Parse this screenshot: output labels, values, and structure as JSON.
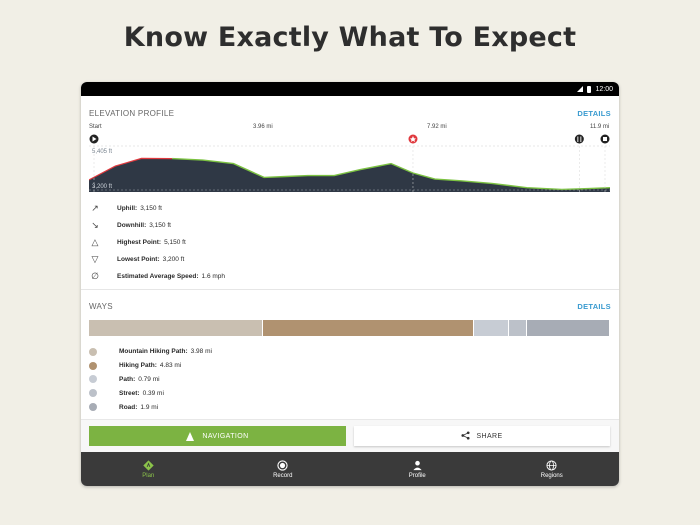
{
  "headline": "Know Exactly What To Expect",
  "status_bar": {
    "time": "12:00"
  },
  "elevation": {
    "title": "ELEVATION PROFILE",
    "details": "DETAILS",
    "ticks": [
      "Start",
      "3.96 mi",
      "7.92 mi",
      "11.9 mi"
    ],
    "y_labels": [
      "5,405 ft",
      "3,200 ft"
    ],
    "stats": [
      {
        "icon": "uphill-icon",
        "glyph": "↗",
        "label": "Uphill:",
        "value": "3,150 ft"
      },
      {
        "icon": "downhill-icon",
        "glyph": "↘",
        "label": "Downhill:",
        "value": "3,150 ft"
      },
      {
        "icon": "highest-point-icon",
        "glyph": "△",
        "label": "Highest Point:",
        "value": "5,150 ft"
      },
      {
        "icon": "lowest-point-icon",
        "glyph": "▽",
        "label": "Lowest Point:",
        "value": "3,200 ft"
      },
      {
        "icon": "average-speed-icon",
        "glyph": "∅",
        "label": "Estimated Average Speed:",
        "value": "1.6 mph"
      }
    ]
  },
  "ways": {
    "title": "WAYS",
    "details": "DETAILS",
    "segments": [
      {
        "name": "Mountain Hiking Path",
        "color": "#c9bfb1",
        "share": 0.334
      },
      {
        "name": "Hiking Path",
        "color": "#b09270",
        "share": 0.405
      },
      {
        "name": "Path",
        "color": "#c7ccd4",
        "share": 0.068
      },
      {
        "name": "Street",
        "color": "#bcc1c9",
        "share": 0.034
      },
      {
        "name": "Road",
        "color": "#a7acb5",
        "share": 0.159
      }
    ],
    "legend": [
      {
        "label": "Mountain Hiking Path:",
        "value": "3.98 mi",
        "color": "#c9bfb1"
      },
      {
        "label": "Hiking Path:",
        "value": "4.83 mi",
        "color": "#b09270"
      },
      {
        "label": "Path:",
        "value": "0.79 mi",
        "color": "#c7ccd4"
      },
      {
        "label": "Street:",
        "value": "0.39 mi",
        "color": "#bcc1c9"
      },
      {
        "label": "Road:",
        "value": "1.9 mi",
        "color": "#a7acb5"
      }
    ]
  },
  "actions": {
    "navigation": "NAVIGATION",
    "share": "SHARE"
  },
  "nav": [
    {
      "label": "Plan",
      "icon": "plan-icon",
      "active": true
    },
    {
      "label": "Record",
      "icon": "record-icon",
      "active": false
    },
    {
      "label": "Profile",
      "icon": "profile-icon",
      "active": false
    },
    {
      "label": "Regions",
      "icon": "regions-icon",
      "active": false
    }
  ],
  "chart_data": {
    "type": "area",
    "x_unit": "mi",
    "y_unit": "ft",
    "x": [
      0,
      0.6,
      1.2,
      1.9,
      2.6,
      3.3,
      4.0,
      4.5,
      5.0,
      5.6,
      6.2,
      6.9,
      7.4,
      7.9,
      8.5,
      9.2,
      10.0,
      10.8,
      11.4,
      11.9
    ],
    "y": [
      3900,
      4700,
      5150,
      5140,
      5050,
      4850,
      4050,
      4100,
      4150,
      4150,
      4500,
      4850,
      4300,
      3950,
      3850,
      3700,
      3450,
      3350,
      3400,
      3450
    ],
    "ylim": [
      3200,
      5405
    ],
    "xlim": [
      0,
      11.9
    ],
    "waypoints": [
      {
        "icon": "start-flag-icon",
        "x": 0
      },
      {
        "icon": "star-poi-icon",
        "x": 7.4
      },
      {
        "icon": "restaurant-icon",
        "x": 11.2
      },
      {
        "icon": "finish-icon",
        "x": 11.9
      }
    ]
  }
}
